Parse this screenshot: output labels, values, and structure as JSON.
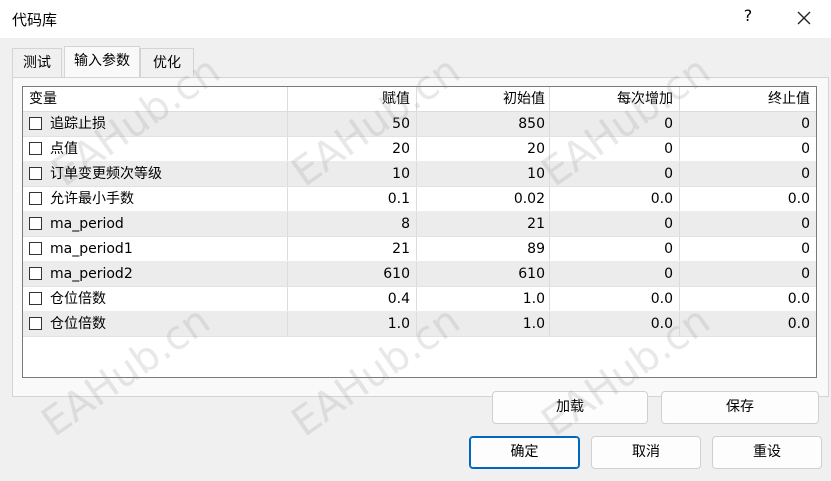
{
  "window": {
    "title": "代码库",
    "help_label": "?"
  },
  "tabs": [
    {
      "label": "测试",
      "active": false
    },
    {
      "label": "输入参数",
      "active": true
    },
    {
      "label": "优化",
      "active": false
    }
  ],
  "table": {
    "columns": [
      "变量",
      "赋值",
      "初始值",
      "每次增加",
      "终止值"
    ],
    "rows": [
      {
        "name": "追踪止损",
        "value": "50",
        "start": "850",
        "step": "0",
        "stop": "0",
        "checked": false
      },
      {
        "name": "点值",
        "value": "20",
        "start": "20",
        "step": "0",
        "stop": "0",
        "checked": false
      },
      {
        "name": "订单变更频次等级",
        "value": "10",
        "start": "10",
        "step": "0",
        "stop": "0",
        "checked": false
      },
      {
        "name": "允许最小手数",
        "value": "0.1",
        "start": "0.02",
        "step": "0.0",
        "stop": "0.0",
        "checked": false
      },
      {
        "name": "ma_period",
        "value": "8",
        "start": "21",
        "step": "0",
        "stop": "0",
        "checked": false
      },
      {
        "name": "ma_period1",
        "value": "21",
        "start": "89",
        "step": "0",
        "stop": "0",
        "checked": false
      },
      {
        "name": "ma_period2",
        "value": "610",
        "start": "610",
        "step": "0",
        "stop": "0",
        "checked": false
      },
      {
        "name": "仓位倍数",
        "value": "0.4",
        "start": "1.0",
        "step": "0.0",
        "stop": "0.0",
        "checked": false
      },
      {
        "name": "仓位倍数",
        "value": "1.0",
        "start": "1.0",
        "step": "0.0",
        "stop": "0.0",
        "checked": false
      }
    ]
  },
  "buttons": {
    "load": "加载",
    "save": "保存",
    "ok": "确定",
    "cancel": "取消",
    "reset": "重设"
  },
  "watermark": "EAHub.cn",
  "colors": {
    "accent": "#0067c0",
    "row_alt": "#ececec"
  }
}
